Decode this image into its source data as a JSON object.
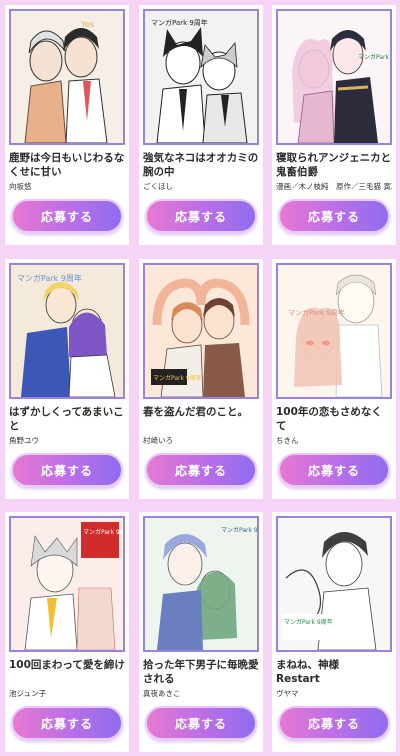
{
  "entries": [
    {
      "title": "鹿野は今日もいじわるなくせに甘い",
      "author": "向坂悠",
      "button": "応募する",
      "icon": "manga-illustration-couple",
      "colors": [
        "#f5efe7",
        "#6e4a37",
        "#e7b18c"
      ]
    },
    {
      "title": "強気なネコはオオカミの腕の中",
      "author": "ごくほし",
      "button": "応募する",
      "icon": "manga-illustration-wolf-cat",
      "colors": [
        "#f2f2f2",
        "#222222",
        "#cccccc"
      ]
    },
    {
      "title": "寝取られアンジェニカと鬼畜伯爵",
      "author": "漫画／木ノ枝純　原作／三毛猫 寅次",
      "button": "応募する",
      "icon": "manga-illustration-princess-earl",
      "colors": [
        "#fbf5f7",
        "#e6b7cf",
        "#2c2c3c"
      ]
    },
    {
      "title": "はずかしくってあまいこと",
      "author": "角野ユウ",
      "button": "応募する",
      "icon": "manga-illustration-embrace",
      "colors": [
        "#f4eadb",
        "#3d57b7",
        "#7e56c6"
      ]
    },
    {
      "title": "春を盗んだ君のこと。",
      "author": "村崎いろ",
      "button": "応募する",
      "icon": "manga-illustration-heart-hands",
      "colors": [
        "#fbe8d9",
        "#d88a5b",
        "#6d4134"
      ]
    },
    {
      "title": "100年の恋もさめなくて",
      "author": "ちきん",
      "button": "応募する",
      "icon": "manga-illustration-blush",
      "colors": [
        "#fdf6ef",
        "#f2c5b5",
        "#d0c6c6"
      ]
    },
    {
      "title": "100回まわって愛を締け",
      "author": "池ジュン子",
      "button": "応募する",
      "icon": "manga-illustration-red-couple",
      "colors": [
        "#fbeeea",
        "#d12c2c",
        "#8a8a8a"
      ]
    },
    {
      "title": "拾った年下男子に毎晩愛される",
      "author": "真夜あきこ",
      "button": "応募する",
      "icon": "manga-illustration-green-couple",
      "colors": [
        "#eef5ef",
        "#6fa77e",
        "#6a7ec0"
      ]
    },
    {
      "title": "まねね、神様　Restart",
      "author": "ヴヤマ",
      "button": "応募する",
      "icon": "manga-illustration-god",
      "colors": [
        "#f7f7f7",
        "#3f3f3f",
        "#1e8e4f"
      ]
    }
  ],
  "labels": {
    "badge": "マンガPark 9周年"
  }
}
